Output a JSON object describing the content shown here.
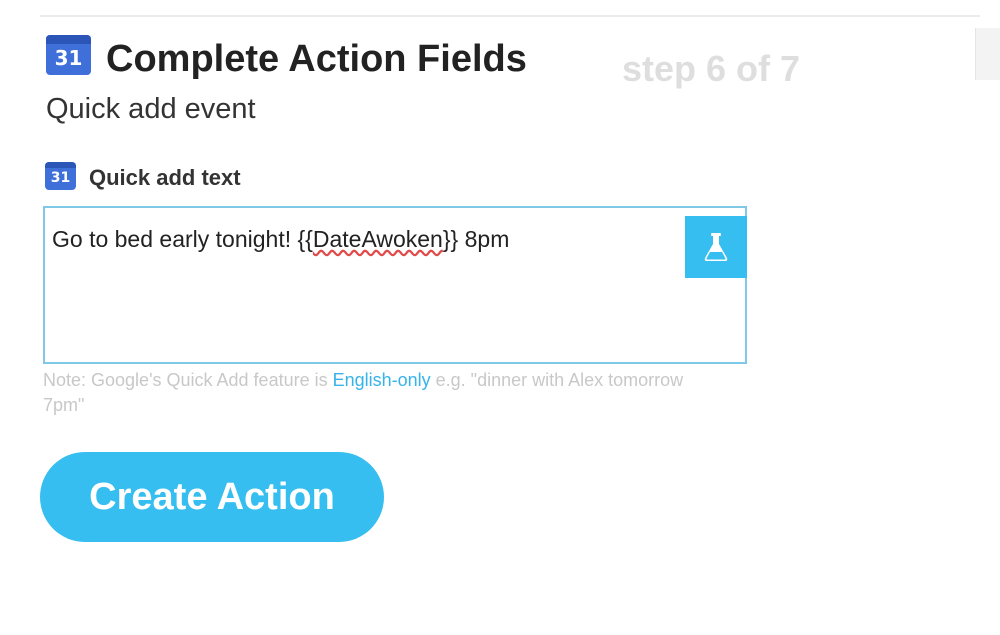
{
  "header": {
    "calendar_icon_text": "31",
    "title": "Complete Action Fields",
    "step_text": "step 6 of 7"
  },
  "action": {
    "name": "Quick add event"
  },
  "field": {
    "icon_text": "31",
    "label": "Quick add text",
    "value_prefix": "Go to bed early tonight! {{",
    "ingredient": "DateAwoken",
    "value_suffix": "}} 8pm",
    "ingredient_button_icon": "flask-icon"
  },
  "note": {
    "prefix": "Note: Google's Quick Add feature is ",
    "link_text": "English-only",
    "suffix": " e.g. \"dinner with Alex tomorrow 7pm\""
  },
  "create_button": {
    "label": "Create Action"
  },
  "colors": {
    "accent": "#36bef0",
    "calendar_blue": "#3f6fd8",
    "step_grey": "#dedede",
    "note_grey": "#c8c8c8"
  }
}
